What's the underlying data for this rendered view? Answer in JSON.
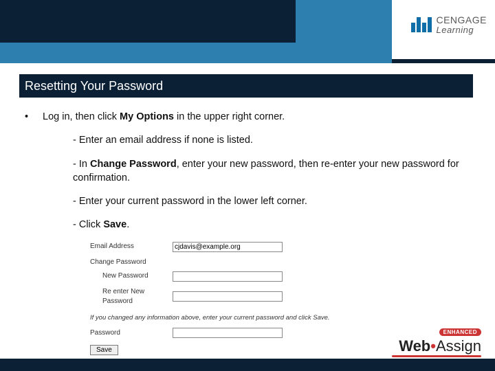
{
  "brand": {
    "top": "CENGAGE",
    "bottom": "Learning"
  },
  "title": "Resetting Your Password",
  "bullet": "•",
  "main_line": {
    "pre": "Log in, then click ",
    "bold": "My Options",
    "post": " in the upper right corner."
  },
  "steps": {
    "s1": "- Enter an email address if none is listed.",
    "s2": {
      "pre": "- In ",
      "bold": "Change Password",
      "post": ", enter your new password, then re-enter your new password for confirmation."
    },
    "s3": "- Enter your current password in the lower left corner.",
    "s4": {
      "pre": "- Click ",
      "bold": "Save",
      "post": "."
    }
  },
  "form": {
    "email_label": "Email Address",
    "email_value": "cjdavis@example.org",
    "change_pw_label": "Change Password",
    "new_pw_label": "New Password",
    "reenter_label": "Re enter New Password",
    "note": "If you changed any information above, enter your current password and click Save.",
    "password_label": "Password",
    "save_label": "Save"
  },
  "wa": {
    "enhanced": "ENHANCED",
    "web": "Web",
    "assign": "Assign"
  }
}
